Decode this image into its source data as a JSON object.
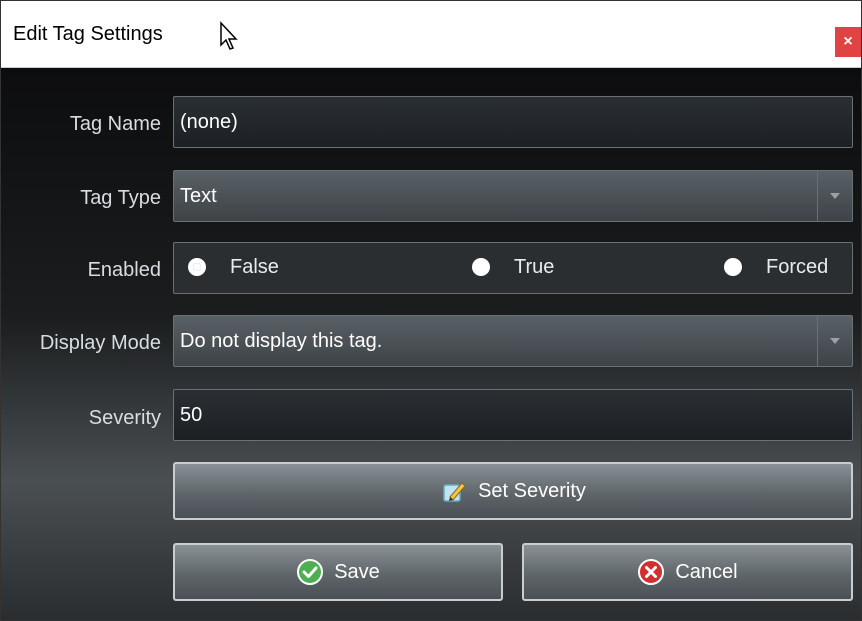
{
  "window": {
    "title": "Edit Tag Settings",
    "close_label": "×"
  },
  "form": {
    "tag_name": {
      "label": "Tag Name",
      "value": "(none)"
    },
    "tag_type": {
      "label": "Tag Type",
      "selected": "Text"
    },
    "enabled": {
      "label": "Enabled",
      "options": [
        {
          "label": "False",
          "checked": true
        },
        {
          "label": "True",
          "checked": false
        },
        {
          "label": "Forced",
          "checked": false
        }
      ]
    },
    "display_mode": {
      "label": "Display Mode",
      "selected": "Do not display this tag."
    },
    "severity": {
      "label": "Severity",
      "value": "50"
    }
  },
  "buttons": {
    "set_severity": "Set Severity",
    "save": "Save",
    "cancel": "Cancel"
  },
  "icons": {
    "set_severity": "pencil-edit-icon",
    "save": "checkmark-icon",
    "cancel": "cancel-x-icon"
  },
  "colors": {
    "close_button": "#e04343",
    "save_icon": "#4caf50",
    "cancel_icon": "#d32f2f"
  }
}
